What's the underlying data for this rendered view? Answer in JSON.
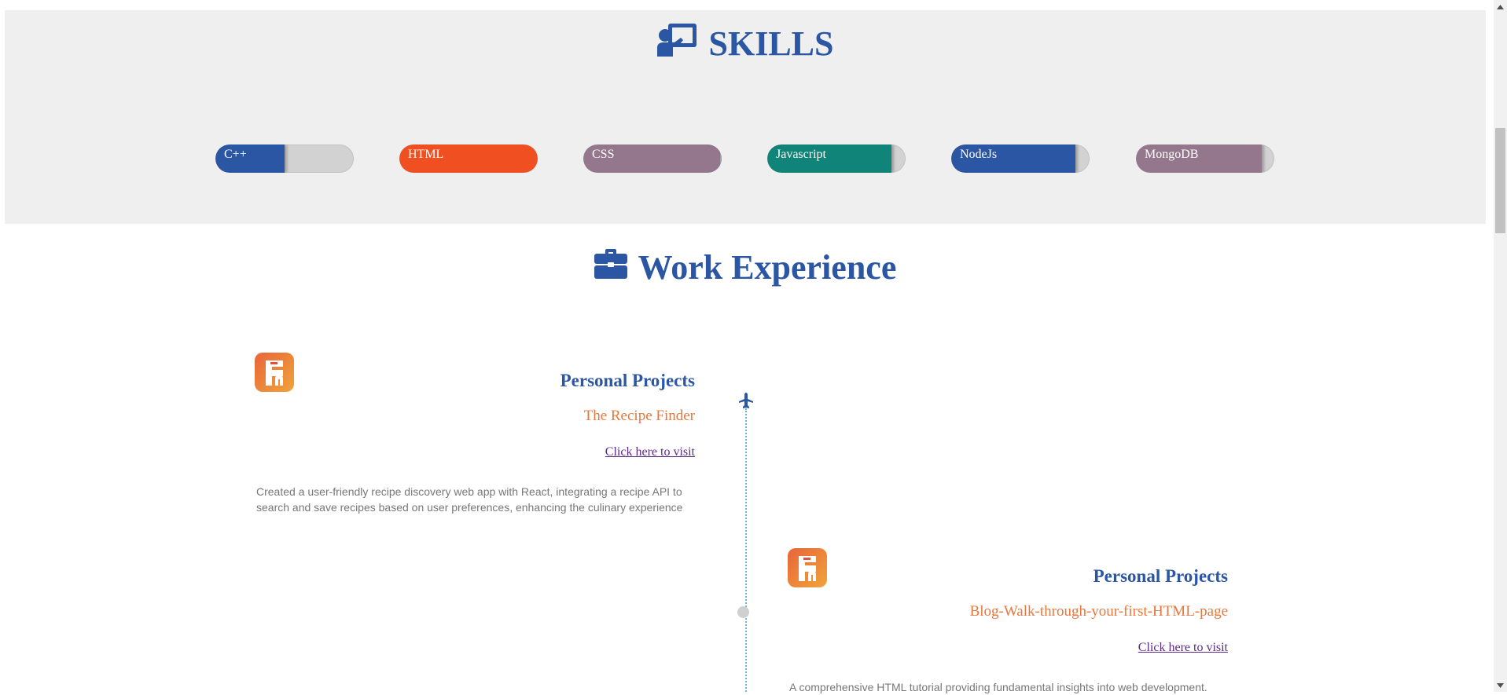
{
  "skills": {
    "title": "SKILLS",
    "icon": "chalkboard-teacher-icon",
    "items": [
      {
        "label": "C++",
        "level_percent": 50,
        "color": "#2a56a3"
      },
      {
        "label": "HTML",
        "level_percent": 100,
        "color": "#ef4f21"
      },
      {
        "label": "CSS",
        "level_percent": 99,
        "color": "#94778c"
      },
      {
        "label": "Javascript",
        "level_percent": 90,
        "color": "#108478"
      },
      {
        "label": "NodeJs",
        "level_percent": 90,
        "color": "#2a56a3"
      },
      {
        "label": "MongoDB",
        "level_percent": 91,
        "color": "#94778c"
      }
    ]
  },
  "work": {
    "title": "Work Experience",
    "icon": "briefcase-icon",
    "entries": [
      {
        "role": "Personal Projects",
        "project": "The Recipe Finder",
        "link_text": "Click here to visit",
        "description": "Created a user-friendly recipe discovery web app with React, integrating a recipe API to search and save recipes based on user preferences, enhancing the culinary experience"
      },
      {
        "role": "Personal Projects",
        "project": "Blog-Walk-through-your-first-HTML-page",
        "link_text": "Click here to visit",
        "description": "A comprehensive HTML tutorial providing fundamental insights into web development."
      }
    ]
  },
  "colors": {
    "accent_blue": "#2a56a3",
    "accent_orange": "#e8773a",
    "link_purple": "#5b2a86",
    "band_gray": "#efefef"
  }
}
